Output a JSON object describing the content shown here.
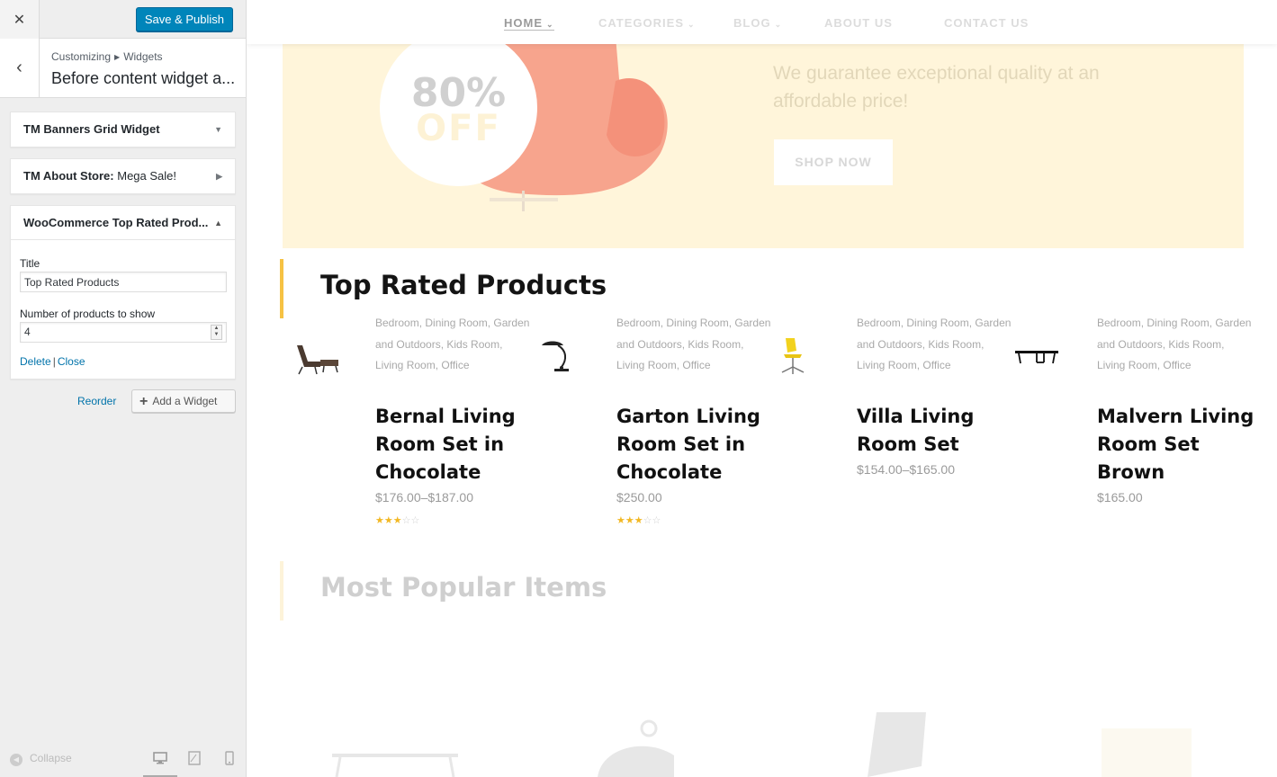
{
  "customizer": {
    "close_icon": "close-icon",
    "publish_label": "Save & Publish",
    "breadcrumb": {
      "root": "Customizing",
      "current": "Widgets"
    },
    "section_title": "Before content widget a...",
    "widgets": [
      {
        "name": "TM Banners Grid Widget",
        "instance_title": "",
        "expanded": false
      },
      {
        "name": "TM About Store:",
        "instance_title": "Mega Sale!",
        "expanded": false
      },
      {
        "name": "WooCommerce Top Rated Prod...",
        "instance_title": "",
        "expanded": true
      }
    ],
    "form": {
      "title_label": "Title",
      "title_value": "Top Rated Products",
      "count_label": "Number of products to show",
      "count_value": "4",
      "delete_label": "Delete",
      "close_label": "Close"
    },
    "reorder_label": "Reorder",
    "add_widget_label": "Add a Widget",
    "collapse_label": "Collapse",
    "accent_color": "#0085ba"
  },
  "preview": {
    "nav": [
      "HOME",
      "CATEGORIES",
      "BLOG",
      "ABOUT US",
      "CONTACT US"
    ],
    "banner": {
      "badge_percent": "80%",
      "badge_off": "OFF",
      "subtitle": "We guarantee exceptional quality at an affordable price!",
      "button": "SHOP NOW",
      "bg_color": "#fff5da"
    },
    "section_title": "Top Rated Products",
    "next_section_title": "Most Popular Items",
    "section_accent": "#f6c243",
    "products": [
      {
        "categories": "Bedroom, Dining Room, Garden and Outdoors, Kids Room, Living Room, Office",
        "name": "Bernal Living Room Set in Chocolate",
        "price": "$176.00–$187.00",
        "rating": 3,
        "max_rating": 5,
        "thumb_icon": "lounge-chair-icon"
      },
      {
        "categories": "Bedroom, Dining Room, Garden and Outdoors, Kids Room, Living Room, Office",
        "name": "Garton Living Room Set in Chocolate",
        "price": "$250.00",
        "rating": 3,
        "max_rating": 5,
        "thumb_icon": "desk-lamp-icon"
      },
      {
        "categories": "Bedroom, Dining Room, Garden and Outdoors, Kids Room, Living Room, Office",
        "name": "Villa Living Room Set",
        "price": "$154.00–$165.00",
        "rating": 0,
        "max_rating": 5,
        "thumb_icon": "office-chair-icon"
      },
      {
        "categories": "Bedroom, Dining Room, Garden and Outdoors, Kids Room, Living Room, Office",
        "name": "Malvern Living Room Set Brown",
        "price": "$165.00",
        "rating": 0,
        "max_rating": 5,
        "thumb_icon": "coffee-table-icon"
      }
    ]
  }
}
